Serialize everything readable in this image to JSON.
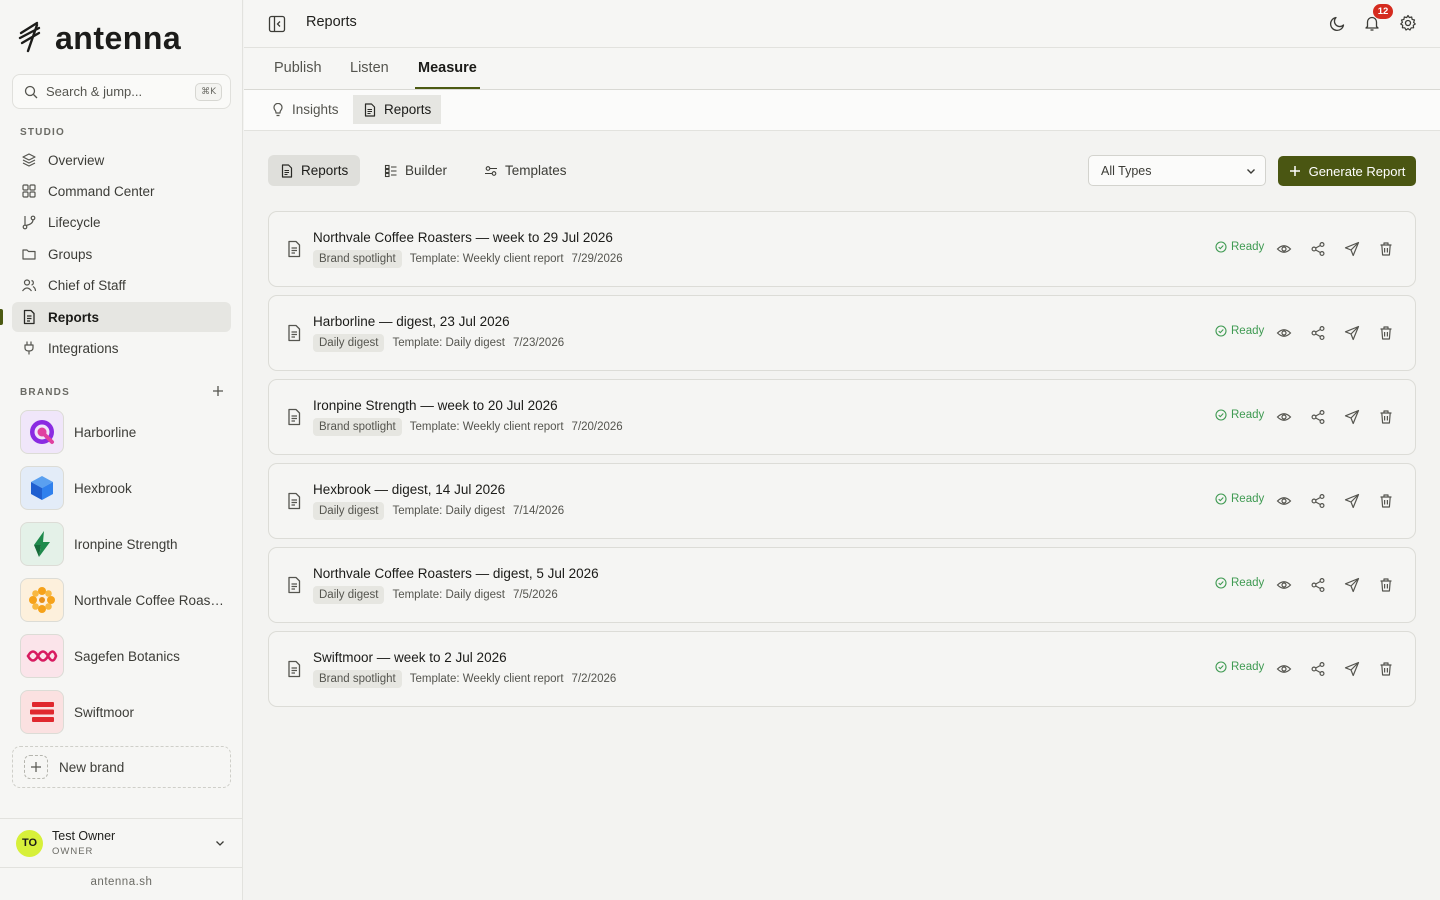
{
  "app": {
    "logo_text": "antenna",
    "footer_domain": "antenna.sh"
  },
  "search": {
    "placeholder": "Search & jump...",
    "shortcut": "⌘K"
  },
  "sidebar": {
    "studio_label": "STUDIO",
    "items": [
      {
        "label": "Overview",
        "icon": "layers-icon"
      },
      {
        "label": "Command Center",
        "icon": "grid-icon"
      },
      {
        "label": "Lifecycle",
        "icon": "git-branch-icon"
      },
      {
        "label": "Groups",
        "icon": "folder-icon"
      },
      {
        "label": "Chief of Staff",
        "icon": "users-icon"
      },
      {
        "label": "Reports",
        "icon": "document-icon",
        "active": true
      },
      {
        "label": "Integrations",
        "icon": "plug-icon"
      }
    ],
    "brands_label": "BRANDS",
    "brands": [
      {
        "name": "Harborline",
        "bg": "#f0e6fa"
      },
      {
        "name": "Hexbrook",
        "bg": "#e3ecf8"
      },
      {
        "name": "Ironpine Strength",
        "bg": "#e4f1e8"
      },
      {
        "name": "Northvale Coffee Roasters",
        "bg": "#fdf0dc"
      },
      {
        "name": "Sagefen Botanics",
        "bg": "#fbe4ea"
      },
      {
        "name": "Swiftmoor",
        "bg": "#fbe1e1"
      }
    ],
    "new_brand_label": "New brand",
    "user": {
      "initials": "TO",
      "name": "Test Owner",
      "role": "OWNER"
    }
  },
  "topbar": {
    "title": "Reports",
    "notifications_count": "12"
  },
  "tabs": [
    {
      "label": "Publish"
    },
    {
      "label": "Listen"
    },
    {
      "label": "Measure",
      "active": true
    }
  ],
  "subtabs": [
    {
      "label": "Insights"
    },
    {
      "label": "Reports",
      "active": true
    }
  ],
  "toolbar": {
    "views": [
      {
        "label": "Reports",
        "active": true
      },
      {
        "label": "Builder"
      },
      {
        "label": "Templates"
      }
    ],
    "type_filter": "All Types",
    "generate_label": "Generate Report"
  },
  "reports": [
    {
      "title": "Northvale Coffee Roasters — week to 29 Jul 2026",
      "tag": "Brand spotlight",
      "template": "Template: Weekly client report",
      "date": "7/29/2026",
      "status": "Ready"
    },
    {
      "title": "Harborline — digest, 23 Jul 2026",
      "tag": "Daily digest",
      "template": "Template: Daily digest",
      "date": "7/23/2026",
      "status": "Ready"
    },
    {
      "title": "Ironpine Strength — week to 20 Jul 2026",
      "tag": "Brand spotlight",
      "template": "Template: Weekly client report",
      "date": "7/20/2026",
      "status": "Ready"
    },
    {
      "title": "Hexbrook — digest, 14 Jul 2026",
      "tag": "Daily digest",
      "template": "Template: Daily digest",
      "date": "7/14/2026",
      "status": "Ready"
    },
    {
      "title": "Northvale Coffee Roasters — digest, 5 Jul 2026",
      "tag": "Daily digest",
      "template": "Template: Daily digest",
      "date": "7/5/2026",
      "status": "Ready"
    },
    {
      "title": "Swiftmoor — week to 2 Jul 2026",
      "tag": "Brand spotlight",
      "template": "Template: Weekly client report",
      "date": "7/2/2026",
      "status": "Ready"
    }
  ],
  "colors": {
    "accent": "#4a5612",
    "ready": "#3f9a52",
    "badge": "#d52b1e",
    "avatar": "#d7f03a"
  }
}
